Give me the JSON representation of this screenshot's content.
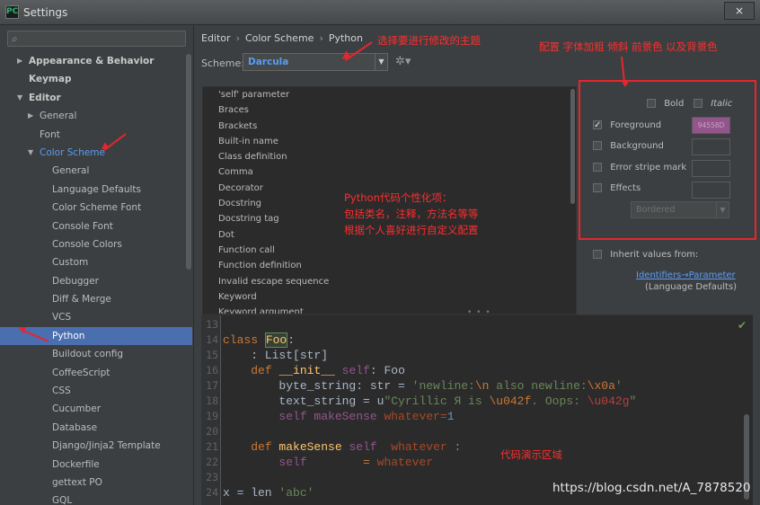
{
  "window": {
    "title": "Settings",
    "close_glyph": "×"
  },
  "search": {
    "placeholder": "",
    "icon": "search-icon"
  },
  "tree": [
    {
      "label": "Appearance & Behavior",
      "level": 0,
      "arrow": "right",
      "style": "bold"
    },
    {
      "label": "Keymap",
      "level": 0,
      "arrow": "",
      "style": "bold"
    },
    {
      "label": "Editor",
      "level": 0,
      "arrow": "down",
      "style": "bold"
    },
    {
      "label": "General",
      "level": 1,
      "arrow": "right",
      "style": ""
    },
    {
      "label": "Font",
      "level": 1,
      "arrow": "",
      "style": ""
    },
    {
      "label": "Color Scheme",
      "level": 1,
      "arrow": "down",
      "style": "link"
    },
    {
      "label": "General",
      "level": 2,
      "arrow": "",
      "style": ""
    },
    {
      "label": "Language Defaults",
      "level": 2,
      "arrow": "",
      "style": ""
    },
    {
      "label": "Color Scheme Font",
      "level": 2,
      "arrow": "",
      "style": ""
    },
    {
      "label": "Console Font",
      "level": 2,
      "arrow": "",
      "style": ""
    },
    {
      "label": "Console Colors",
      "level": 2,
      "arrow": "",
      "style": ""
    },
    {
      "label": "Custom",
      "level": 2,
      "arrow": "",
      "style": ""
    },
    {
      "label": "Debugger",
      "level": 2,
      "arrow": "",
      "style": ""
    },
    {
      "label": "Diff & Merge",
      "level": 2,
      "arrow": "",
      "style": ""
    },
    {
      "label": "VCS",
      "level": 2,
      "arrow": "",
      "style": ""
    },
    {
      "label": "Python",
      "level": 2,
      "arrow": "",
      "style": "selected"
    },
    {
      "label": "Buildout config",
      "level": 2,
      "arrow": "",
      "style": ""
    },
    {
      "label": "CoffeeScript",
      "level": 2,
      "arrow": "",
      "style": ""
    },
    {
      "label": "CSS",
      "level": 2,
      "arrow": "",
      "style": ""
    },
    {
      "label": "Cucumber",
      "level": 2,
      "arrow": "",
      "style": ""
    },
    {
      "label": "Database",
      "level": 2,
      "arrow": "",
      "style": ""
    },
    {
      "label": "Django/Jinja2 Template",
      "level": 2,
      "arrow": "",
      "style": ""
    },
    {
      "label": "Dockerfile",
      "level": 2,
      "arrow": "",
      "style": ""
    },
    {
      "label": "gettext PO",
      "level": 2,
      "arrow": "",
      "style": ""
    },
    {
      "label": "GQL",
      "level": 2,
      "arrow": "",
      "style": ""
    }
  ],
  "breadcrumb": {
    "editor": "Editor",
    "color_scheme": "Color Scheme",
    "python": "Python",
    "sep": "›"
  },
  "scheme": {
    "label": "Scheme:",
    "value": "Darcula"
  },
  "attributes": [
    "'self' parameter",
    "Braces",
    "Brackets",
    "Built-in name",
    "Class definition",
    "Comma",
    "Decorator",
    "Docstring",
    "Docstring tag",
    "Dot",
    "Function call",
    "Function definition",
    "Invalid escape sequence",
    "Keyword",
    "Keyword argument"
  ],
  "options": {
    "bold": "Bold",
    "italic": "Italic",
    "foreground": "Foreground",
    "foreground_value": "94558D",
    "background": "Background",
    "error_stripe": "Error stripe mark",
    "effects": "Effects",
    "effects_value": "Bordered",
    "inherit": "Inherit values from:",
    "inherit_link": "Identifiers→Parameter",
    "inherit_sub": "(Language Defaults)"
  },
  "colors": {
    "foreground_swatch": "#94558d",
    "selected": "#4b6eaf",
    "link": "#589df6",
    "annotation": "#e5262d"
  },
  "code": {
    "lines": [
      "13",
      "14",
      "15",
      "16",
      "17",
      "18",
      "19",
      "20",
      "21",
      "22",
      "23",
      "24"
    ],
    "l14_kw": "class",
    "l14_name": "Foo",
    "l14_colon": ":",
    "l15": "    : List[str]",
    "l16_indent": "    ",
    "l16_kw": "def",
    "l16_fn": "__init__",
    "l16_rest1": " ",
    "l16_self": "self",
    "l16_rest2": ": Foo ",
    "l17_pre": "        byte_string: str = ",
    "l17_str1": "'newline:",
    "l17_esc1": "\\n",
    "l17_str2": " also newline:",
    "l17_esc2": "\\x0a",
    "l17_str3": "'",
    "l18_pre": "        text_string = u",
    "l18_str1": "\"Cyrillic Я is ",
    "l18_esc1": "\\u042f",
    "l18_str2": ". Oops: ",
    "l18_esc2": "\\u042g",
    "l18_str3": "\"",
    "l19_self": "        self",
    "l19_mid": " makeSense ",
    "l19_param": "whatever",
    "l19_eq": "=",
    "l19_num": "1",
    "l21_indent": "    ",
    "l21_kw": "def",
    "l21_fn": " makeSense",
    "l21_mid": " ",
    "l21_self": "self",
    "l21_sp": "  ",
    "l21_param": "whatever",
    "l21_end": " :",
    "l22_self": "        self",
    "l22_mid": "        = ",
    "l22_param": "whatever",
    "l24_pre": "x = len ",
    "l24_str": "'abc'"
  },
  "annotations": {
    "scheme_note": "选择要进行修改的主题",
    "config_note": "配置 字体加粗 倾斜 前景色 以及背景色",
    "python_note_1": "Python代码个性化项：",
    "python_note_2": "包括类名，注释，方法名等等",
    "python_note_3": "根据个人喜好进行自定义配置",
    "demo_note": "代码演示区域",
    "watermark": "https://blog.csdn.net/A_7878520"
  }
}
